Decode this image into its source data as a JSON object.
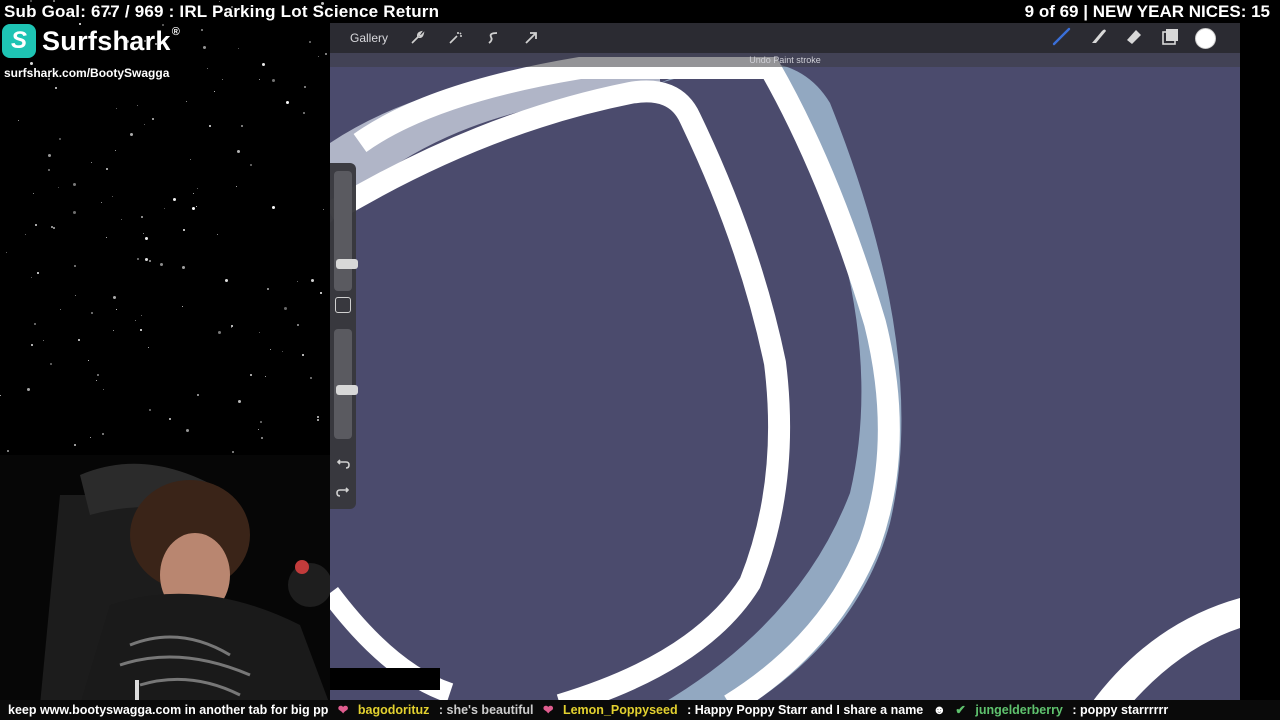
{
  "overlay": {
    "sub_goal": "Sub Goal: 677 / 969 : IRL Parking Lot Science Return",
    "counter": "9 of 69 | NEW YEAR NICES: 15",
    "sponsor_name": "Surfshark",
    "sponsor_mark": "®",
    "sponsor_logo_letter": "S",
    "sponsor_url": "surfshark.com/BootySwagga"
  },
  "app": {
    "gallery_label": "Gallery",
    "undo_toast": "Undo Paint stroke",
    "tools_left": [
      "wrench-icon",
      "magic-wand-icon",
      "selection-icon",
      "transform-arrow-icon"
    ],
    "tools_right": [
      "brush-icon",
      "smudge-icon",
      "eraser-icon",
      "layers-icon",
      "color-picker"
    ],
    "active_tool": "brush",
    "brush_color": "#3a6fd8",
    "current_color": "#ffffff",
    "canvas_fill": "#4b4b6d",
    "outline_color": "#ffffff",
    "highlight_color": "#a9c7dd"
  },
  "ticker": {
    "msg1": "keep www.bootyswagga.com in another tab for big pp",
    "user2": "bagodorituz",
    "msg2": ": she's beautiful",
    "user3": "Lemon_Poppyseed",
    "msg3": ": Happy Poppy Starr and I share a name",
    "user4": "jungelderberry",
    "msg4": ": poppy starrrrrr"
  }
}
